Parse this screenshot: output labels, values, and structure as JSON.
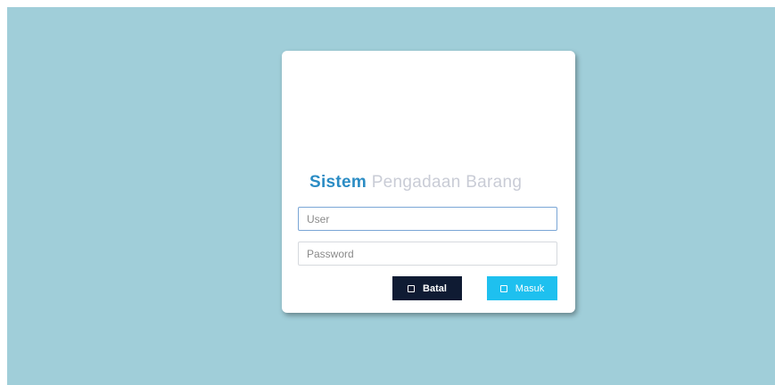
{
  "login": {
    "title_strong": "Sistem",
    "title_light": "Pengadaan Barang",
    "user_placeholder": "User",
    "user_value": "",
    "password_placeholder": "Password",
    "password_value": "",
    "cancel_label": "Batal",
    "cancel_icon": "square-icon",
    "submit_label": "Masuk",
    "submit_icon": "square-icon"
  },
  "colors": {
    "page_background": "#a0ced9",
    "card_background": "#ffffff",
    "title_accent": "#2b8cc4",
    "title_muted": "#c9ccd6",
    "cancel_button": "#0f1b33",
    "submit_button": "#1ec0ef"
  }
}
